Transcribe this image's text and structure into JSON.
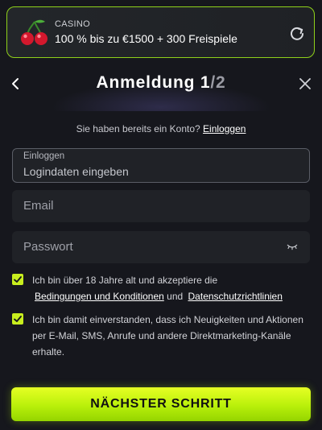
{
  "promo": {
    "category": "CASINO",
    "offer": "100 % bis zu €1500 + 300 Freispiele",
    "icon": "cherries-icon",
    "refresh_icon": "refresh-icon",
    "accent": "#8fd11a"
  },
  "header": {
    "title_prefix": "Anmeldung ",
    "step": "1",
    "total": "/2",
    "back_icon": "chevron-left-icon",
    "close_icon": "close-icon"
  },
  "login_prompt": {
    "text": "Sie haben bereits ein Konto? ",
    "link": "Einloggen"
  },
  "form": {
    "login": {
      "label": "Einloggen",
      "placeholder": "Logindaten eingeben"
    },
    "email": {
      "placeholder": "Email"
    },
    "password": {
      "placeholder": "Passwort",
      "icon": "eye-closed-icon"
    }
  },
  "consents": [
    {
      "checked": true,
      "text_before": "Ich bin über 18 Jahre alt und akzeptiere die",
      "link1": "Bedingungen und Konditionen",
      "middle": " und ",
      "link2": "Datenschutzrichtlinien"
    },
    {
      "checked": true,
      "text": "Ich bin damit einverstanden, dass ich Neuigkeiten und Aktionen per E-Mail, SMS, Anrufe und andere Direktmarketing-Kanäle erhalte."
    }
  ],
  "cta": {
    "label": "NÄCHSTER SCHRITT",
    "color": "#c8ee1e"
  }
}
